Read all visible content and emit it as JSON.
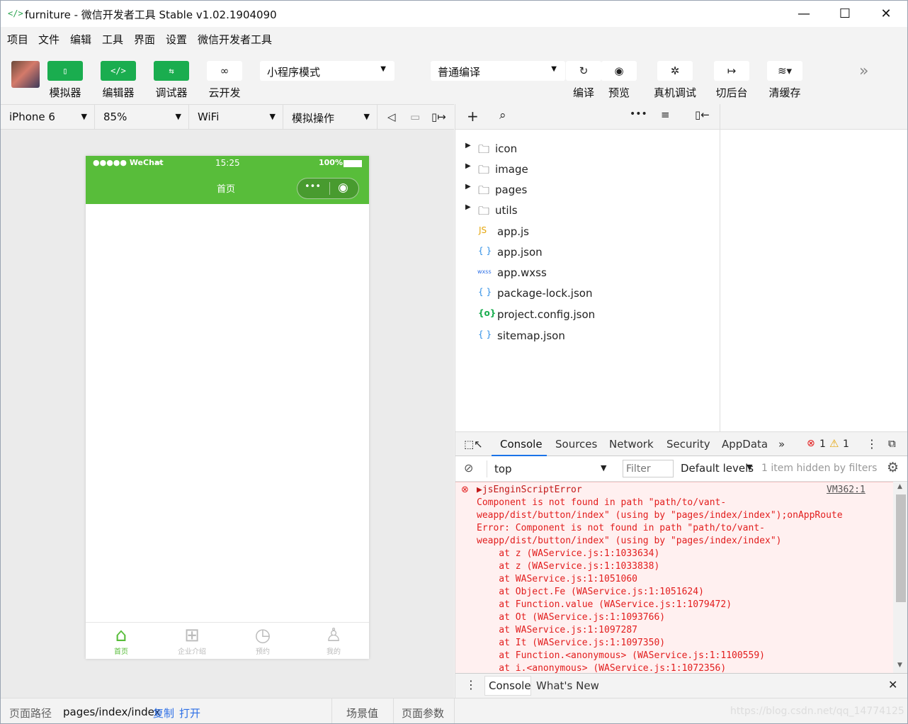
{
  "window": {
    "title": "furniture - 微信开发者工具 Stable v1.02.1904090",
    "minimize": "—",
    "maximize": "☐",
    "close": "✕"
  },
  "menu": [
    "项目",
    "文件",
    "编辑",
    "工具",
    "界面",
    "设置",
    "微信开发者工具"
  ],
  "toolbar": {
    "simulator": "模拟器",
    "editor": "编辑器",
    "debugger": "调试器",
    "cloud": "云开发",
    "mode": "小程序模式",
    "compile_mode": "普通编译",
    "compile": "编译",
    "preview": "预览",
    "real_debug": "真机调试",
    "background": "切后台",
    "clear_cache": "清缓存",
    "more": "»"
  },
  "simbar": {
    "device": "iPhone 6",
    "zoom": "85%",
    "network": "WiFi",
    "operation": "模拟操作"
  },
  "phone": {
    "carrier": "●●●●● WeChat",
    "time": "15:25",
    "battery": "100%",
    "page_title": "首页",
    "tabs": [
      {
        "label": "首页",
        "icon": "home-icon"
      },
      {
        "label": "企业介绍",
        "icon": "grid-icon"
      },
      {
        "label": "预约",
        "icon": "clock-icon"
      },
      {
        "label": "我的",
        "icon": "user-icon"
      }
    ]
  },
  "explorer": {
    "folders": [
      "icon",
      "image",
      "pages",
      "utils"
    ],
    "files": [
      {
        "badge": "JS",
        "name": "app.js",
        "color": "#e5a50a"
      },
      {
        "badge": "{ }",
        "name": "app.json",
        "color": "#2d8ee6"
      },
      {
        "badge": "wxss",
        "name": "app.wxss",
        "color": "#2d6fe6"
      },
      {
        "badge": "{ }",
        "name": "package-lock.json",
        "color": "#2d8ee6"
      },
      {
        "badge": "{o}",
        "name": "project.config.json",
        "color": "#1aad4f"
      },
      {
        "badge": "{ }",
        "name": "sitemap.json",
        "color": "#2d8ee6"
      }
    ]
  },
  "devtools": {
    "tabs": [
      "Console",
      "Sources",
      "Network",
      "Security",
      "AppData"
    ],
    "more": "»",
    "errors": "1",
    "warnings": "1",
    "context": "top",
    "filter_placeholder": "Filter",
    "levels": "Default levels",
    "hidden": "1 item hidden by filters",
    "source_link": "VM362:1",
    "log": [
      "▶jsEnginScriptError",
      "Component is not found in path \"path/to/vant-",
      "weapp/dist/button/index\" (using by \"pages/index/index\");onAppRoute",
      "Error: Component is not found in path \"path/to/vant-",
      "weapp/dist/button/index\" (using by \"pages/index/index\")",
      "    at z (WAService.js:1:1033634)",
      "    at z (WAService.js:1:1033838)",
      "    at WAService.js:1:1051060",
      "    at Object.Fe (WAService.js:1:1051624)",
      "    at Function.value (WAService.js:1:1079472)",
      "    at Ot (WAService.js:1:1093766)",
      "    at WAService.js:1:1097287",
      "    at It (WAService.js:1:1097350)",
      "    at Function.<anonymous> (WAService.js:1:1100559)",
      "    at i.<anonymous> (WAService.js:1:1072356)"
    ],
    "drawer_tabs": [
      "Console",
      "What's New"
    ]
  },
  "status": {
    "path_label": "页面路径",
    "path": "pages/index/index",
    "copy": "复制",
    "open": "打开",
    "scene": "场景值",
    "params": "页面参数",
    "watermark": "https://blog.csdn.net/qq_14774125"
  }
}
